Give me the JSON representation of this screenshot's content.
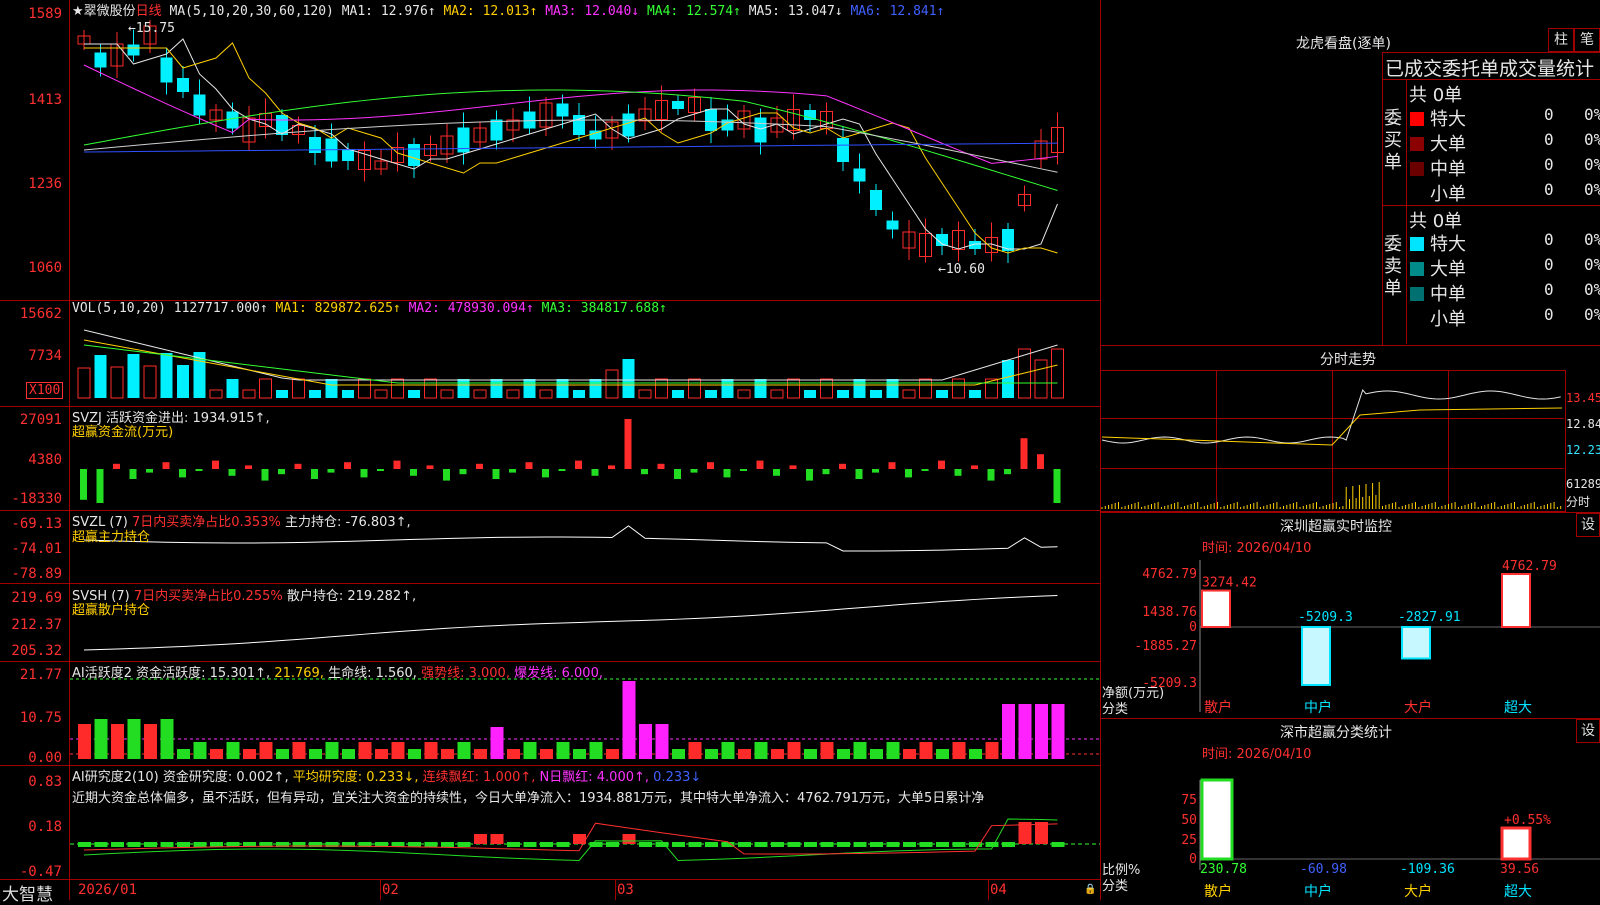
{
  "stock": {
    "name": "★翠微股份",
    "period": "日线"
  },
  "ma_line": {
    "label": "MA(5,10,20,30,60,120)",
    "items": [
      {
        "t": "MA1: 12.976↑",
        "c": "wht"
      },
      {
        "t": "MA2: 12.013↑",
        "c": "yel"
      },
      {
        "t": "MA3: 12.040↓",
        "c": "mag"
      },
      {
        "t": "MA4: 12.574↑",
        "c": "grn"
      },
      {
        "t": "MA5: 13.047↓",
        "c": "wht"
      },
      {
        "t": "MA6: 12.841↑",
        "c": "blu"
      }
    ]
  },
  "price_axis": [
    "1589",
    "1413",
    "1236",
    "1060"
  ],
  "price_marks": {
    "high": "←15.75",
    "low": "←10.60"
  },
  "vol": {
    "label": "VOL(5,10,20)",
    "value": "1127717.000↑",
    "ma1": "MA1: 829872.625↑",
    "ma2": "MA2: 478930.094↑",
    "ma3": "MA3: 384817.688↑",
    "axis": [
      "15662",
      "7734"
    ],
    "unit": "X100"
  },
  "svzj": {
    "label": "SVZJ  活跃资金进出: 1934.915↑,",
    "sub": "超赢资金流(万元)",
    "axis": [
      "27091",
      "4380",
      "-18330"
    ]
  },
  "svzl": {
    "label": "SVZL (7)",
    "ratio": "7日内买卖净占比0.353%",
    "hold": "主力持仓: -76.803↑,",
    "sub": "超赢主力持仓",
    "axis": [
      "-69.13",
      "-74.01",
      "-78.89"
    ]
  },
  "svsh": {
    "label": "SVSH (7)",
    "ratio": "7日内买卖净占比0.255%",
    "hold": "散户持仓: 219.282↑,",
    "sub": "超赢散户持仓",
    "axis": [
      "219.69",
      "212.37",
      "205.32"
    ]
  },
  "ai1": {
    "label": "AI活跃度2",
    "a": "资金活跃度: 15.301↑,",
    "b": "21.769,",
    "c": "生命线: 1.560,",
    "d": "强势线: 3.000,",
    "e": "爆发线: 6.000,",
    "axis": [
      "21.77",
      "10.75",
      "0.00"
    ]
  },
  "ai2": {
    "label": "AI研究度2(10)",
    "a": "资金研究度: 0.002↑,",
    "b": "平均研究度: 0.233↓,",
    "c": "连续飘红: 1.000↑,",
    "d": "N日飘红: 4.000↑,",
    "e": "0.233↓",
    "text": "近期大资金总体偏多，虽不活跃，但有异动，宜关注大资金的持续性，今日大单净流入：1934.881万元，其中特大单净流入：4762.791万元，大单5日累计净",
    "axis": [
      "0.83",
      "0.18",
      "-0.47"
    ]
  },
  "dates": [
    "2026/01",
    "02",
    "03",
    "04"
  ],
  "brand": "大智慧",
  "lhb": {
    "title": "龙虎看盘(逐单)",
    "btn1": "柱",
    "btn2": "笔",
    "sub": "已成交委托单成交量统计",
    "buy": {
      "side": "委买单",
      "total": "共 0单",
      "rows": [
        {
          "n": "特大",
          "v": "0",
          "p": "0%",
          "c": "#ff0000"
        },
        {
          "n": "大单",
          "v": "0",
          "p": "0%",
          "c": "#8b0000"
        },
        {
          "n": "中单",
          "v": "0",
          "p": "0%",
          "c": "#6b0000"
        },
        {
          "n": "小单",
          "v": "0",
          "p": "0%",
          "c": ""
        }
      ]
    },
    "sell": {
      "side": "委卖单",
      "total": "共 0单",
      "rows": [
        {
          "n": "特大",
          "v": "0",
          "p": "0%",
          "c": "#00e5ff"
        },
        {
          "n": "大单",
          "v": "0",
          "p": "0%",
          "c": "#008b8b"
        },
        {
          "n": "中单",
          "v": "0",
          "p": "0%",
          "c": "#007070"
        },
        {
          "n": "小单",
          "v": "0",
          "p": "0%",
          "c": ""
        }
      ]
    }
  },
  "fs": {
    "title": "分时走势",
    "axis": [
      "13.45",
      "12.84",
      "12.23",
      "61289",
      "分时"
    ]
  },
  "monitor": {
    "title": "深圳超赢实时监控",
    "btn": "设",
    "time": "时间: 2026/04/10",
    "axis": [
      "4762.79",
      "1438.76",
      "0",
      "-1885.27",
      "-5209.3"
    ],
    "vals": [
      "3274.42",
      "-5209.3",
      "-2827.91",
      "4762.79"
    ],
    "ylabel": "净额(万元)",
    "xlabel": "分类",
    "cats": [
      "散户",
      "中户",
      "大户",
      "超大"
    ]
  },
  "stats": {
    "title": "深市超赢分类统计",
    "btn": "设",
    "time": "时间: 2026/04/10",
    "axis": [
      "75",
      "50",
      "25",
      "0"
    ],
    "vals": [
      "230.78",
      "-60.98",
      "-109.36",
      "39.56"
    ],
    "pct": "+0.55%",
    "ylabel": "比例%",
    "xlabel": "分类",
    "cats": [
      "散户",
      "中户",
      "大户",
      "超大"
    ]
  }
}
